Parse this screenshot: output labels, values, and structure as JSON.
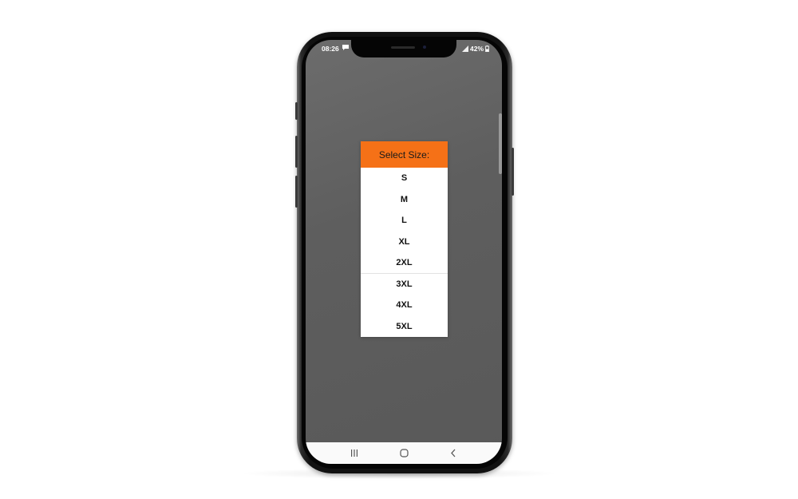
{
  "status_bar": {
    "time": "08:26",
    "battery": "42%"
  },
  "dialog": {
    "title": "Select Size:",
    "header_color": "#f57117",
    "options": [
      "S",
      "M",
      "L",
      "XL",
      "2XL",
      "3XL",
      "4XL",
      "5XL"
    ]
  },
  "nav_bar": {
    "icons": [
      "recent-apps-icon",
      "home-icon",
      "back-icon"
    ]
  }
}
